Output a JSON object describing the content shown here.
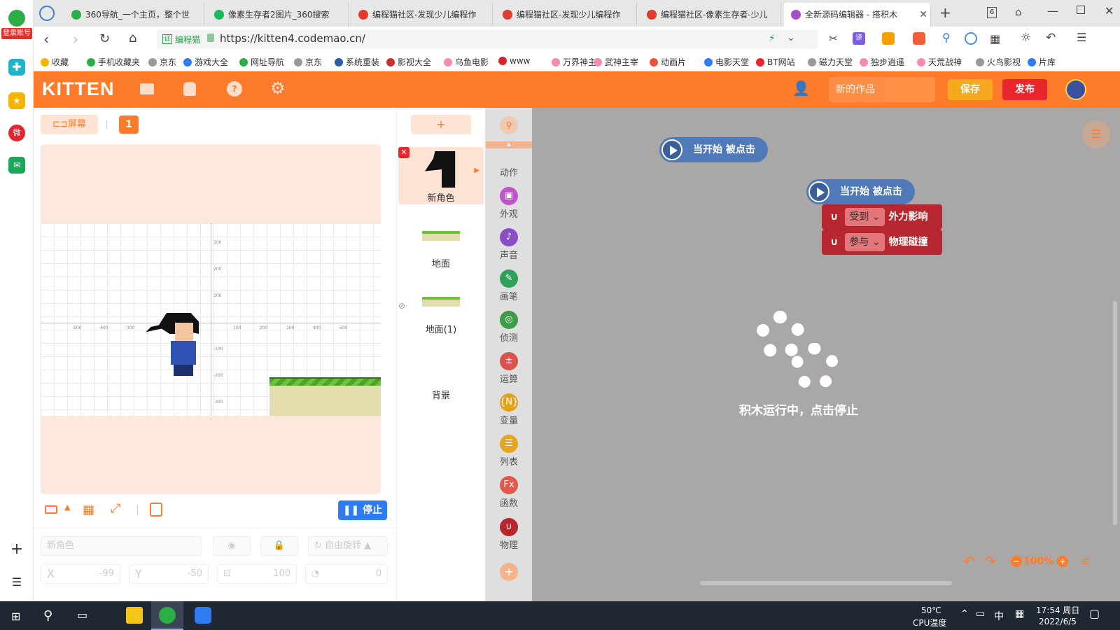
{
  "browser": {
    "tabs": [
      {
        "label": "360导航_一个主页，整个世",
        "color": "#2cae46"
      },
      {
        "label": "像素生存者2图片_360搜索",
        "color": "#19b955"
      },
      {
        "label": "编程猫社区-发现少儿编程作",
        "color": "#e03b2b"
      },
      {
        "label": "编程猫社区-发现少儿编程作",
        "color": "#e03b2b"
      },
      {
        "label": "编程猫社区-像素生存者-少儿",
        "color": "#e03b2b"
      },
      {
        "label": "全新源码编辑器 - 搭积木",
        "color": "#a64dc9"
      }
    ],
    "tab_count": "6",
    "url_badge": "编程猫",
    "url": "https://kitten4.codemao.cn/",
    "bookmarks": [
      "收藏",
      "手机收藏夹",
      "京东",
      "游戏大全",
      "网址导航",
      "京东",
      "系统重装",
      "影视大全",
      "乌鱼电影",
      "www",
      "万界神主",
      "武神主宰",
      "动画片",
      "电影天堂",
      "BT网站",
      "磁力天堂",
      "独步逍遥",
      "天荒战神",
      "火鸟影视",
      "片库"
    ],
    "login_label": "登录账号"
  },
  "app": {
    "logo": "KITTEN",
    "project_name": "新的作品",
    "save_label": "保存",
    "publish_label": "发布",
    "accent": "#fd7b2a"
  },
  "stage": {
    "screen_label": "屏幕",
    "screen_number": "1",
    "stop_label": "停止",
    "axis_x_neg": [
      "-500",
      "-400",
      "-300",
      "-200",
      "-100"
    ],
    "axis_x_pos": [
      "100",
      "200",
      "300",
      "400",
      "500"
    ],
    "axis_y_pos": [
      "300",
      "200",
      "100"
    ],
    "axis_y_neg": [
      "-100",
      "-200",
      "-300"
    ]
  },
  "sprites": {
    "add_label": "+",
    "items": [
      "新角色",
      "地面",
      "地面(1)",
      "背景"
    ]
  },
  "props": {
    "name_placeholder": "新角色",
    "rotation_label": "自由旋转",
    "x_label": "X",
    "x_value": "-99",
    "y_label": "Y",
    "y_value": "-50",
    "size_value": "100",
    "rotate_value": "0"
  },
  "categories": [
    {
      "label": "动作",
      "color": "#5c92d6"
    },
    {
      "label": "外观",
      "color": "#c153c9"
    },
    {
      "label": "声音",
      "color": "#8a4fc7"
    },
    {
      "label": "画笔",
      "color": "#2f9f5a"
    },
    {
      "label": "侦测",
      "color": "#3b9b47"
    },
    {
      "label": "运算",
      "color": "#d9534f"
    },
    {
      "label": "变量",
      "color": "#e2a11a"
    },
    {
      "label": "列表",
      "color": "#e6a41f"
    },
    {
      "label": "函数",
      "color": "#e0584a"
    },
    {
      "label": "物理",
      "color": "#b8272f"
    }
  ],
  "blocks": {
    "hat1": "当开始 被点击",
    "hat2": "当开始 被点击",
    "phys1_dd": "受到",
    "phys1_text": "外力影响",
    "phys2_dd": "参与",
    "phys2_text": "物理碰撞"
  },
  "overlay": {
    "running_text": "积木运行中，点击停止"
  },
  "zoom": {
    "value": "100%"
  },
  "taskbar": {
    "temp": "50℃",
    "temp_label": "CPU温度",
    "ime": "中",
    "time": "17:54 周日",
    "date": "2022/6/5"
  }
}
